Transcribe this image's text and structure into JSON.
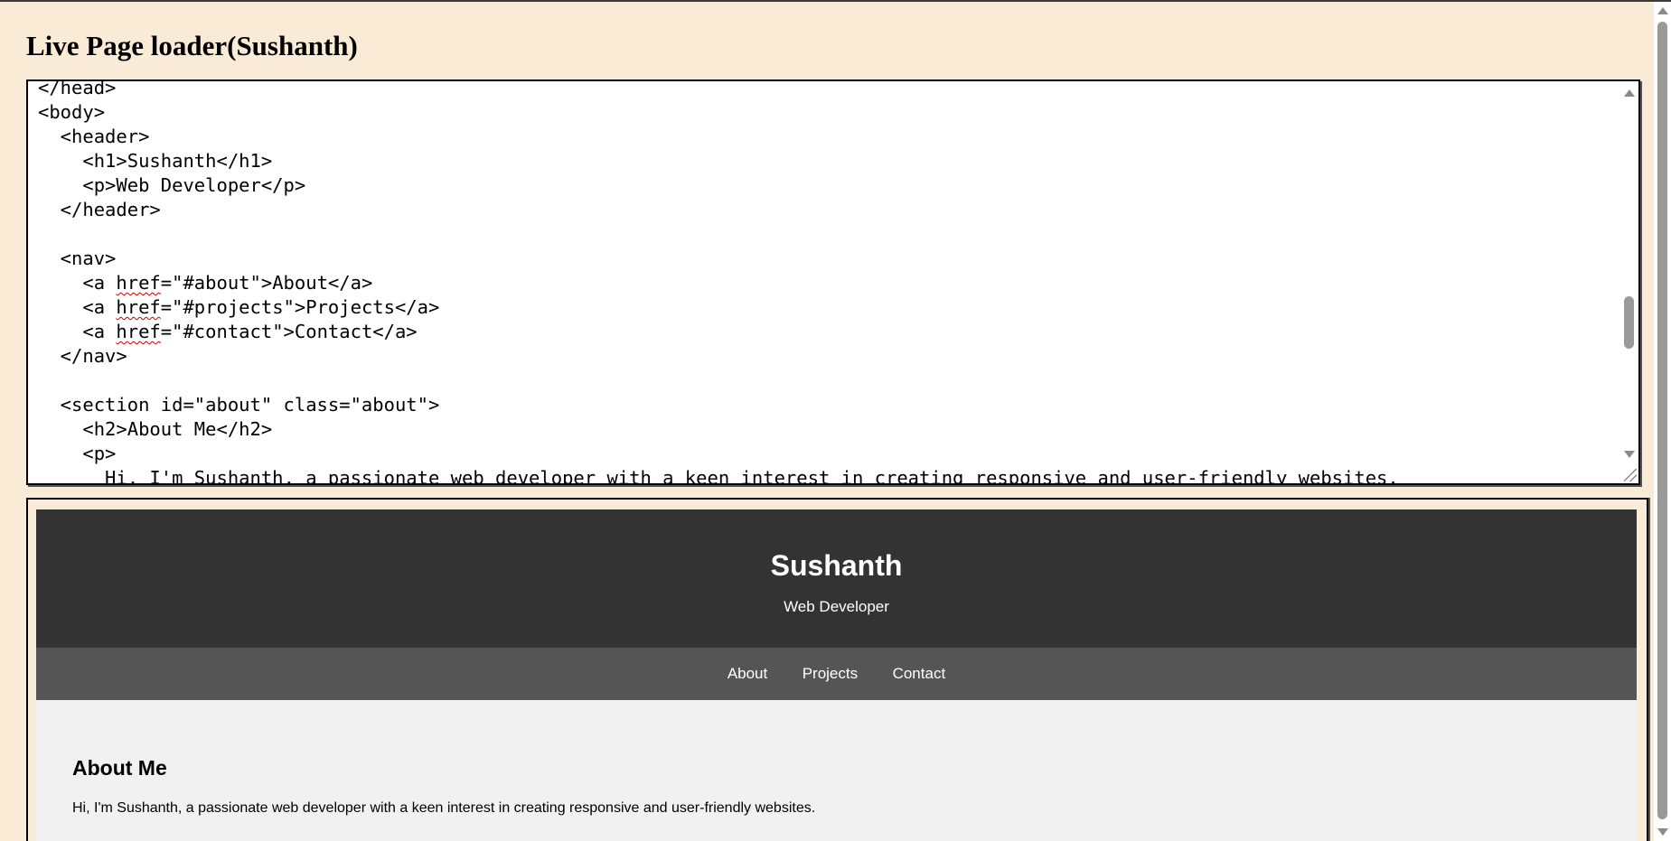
{
  "page": {
    "title": "Live Page loader(Sushanth)"
  },
  "editor": {
    "lines": [
      "</head>",
      "<body>",
      "  <header>",
      "    <h1>Sushanth</h1>",
      "    <p>Web Developer</p>",
      "  </header>",
      "",
      "  <nav>",
      "    <a href=\"#about\">About</a>",
      "    <a href=\"#projects\">Projects</a>",
      "    <a href=\"#contact\">Contact</a>",
      "  </nav>",
      "",
      "  <section id=\"about\" class=\"about\">",
      "    <h2>About Me</h2>",
      "    <p>",
      "      Hi, I'm Sushanth, a passionate web developer with a keen interest in creating responsive and user-friendly websites."
    ],
    "spellcheck_word": "href"
  },
  "preview": {
    "header": {
      "name": "Sushanth",
      "role": "Web Developer"
    },
    "nav": {
      "items": [
        "About",
        "Projects",
        "Contact"
      ]
    },
    "about": {
      "heading": "About Me",
      "text": "Hi, I'm Sushanth, a passionate web developer with a keen interest in creating responsive and user-friendly websites."
    }
  },
  "colors": {
    "page_background": "#FAEBD7",
    "preview_header": "#333333",
    "preview_nav": "#555555",
    "preview_body": "#f1f1f1"
  }
}
